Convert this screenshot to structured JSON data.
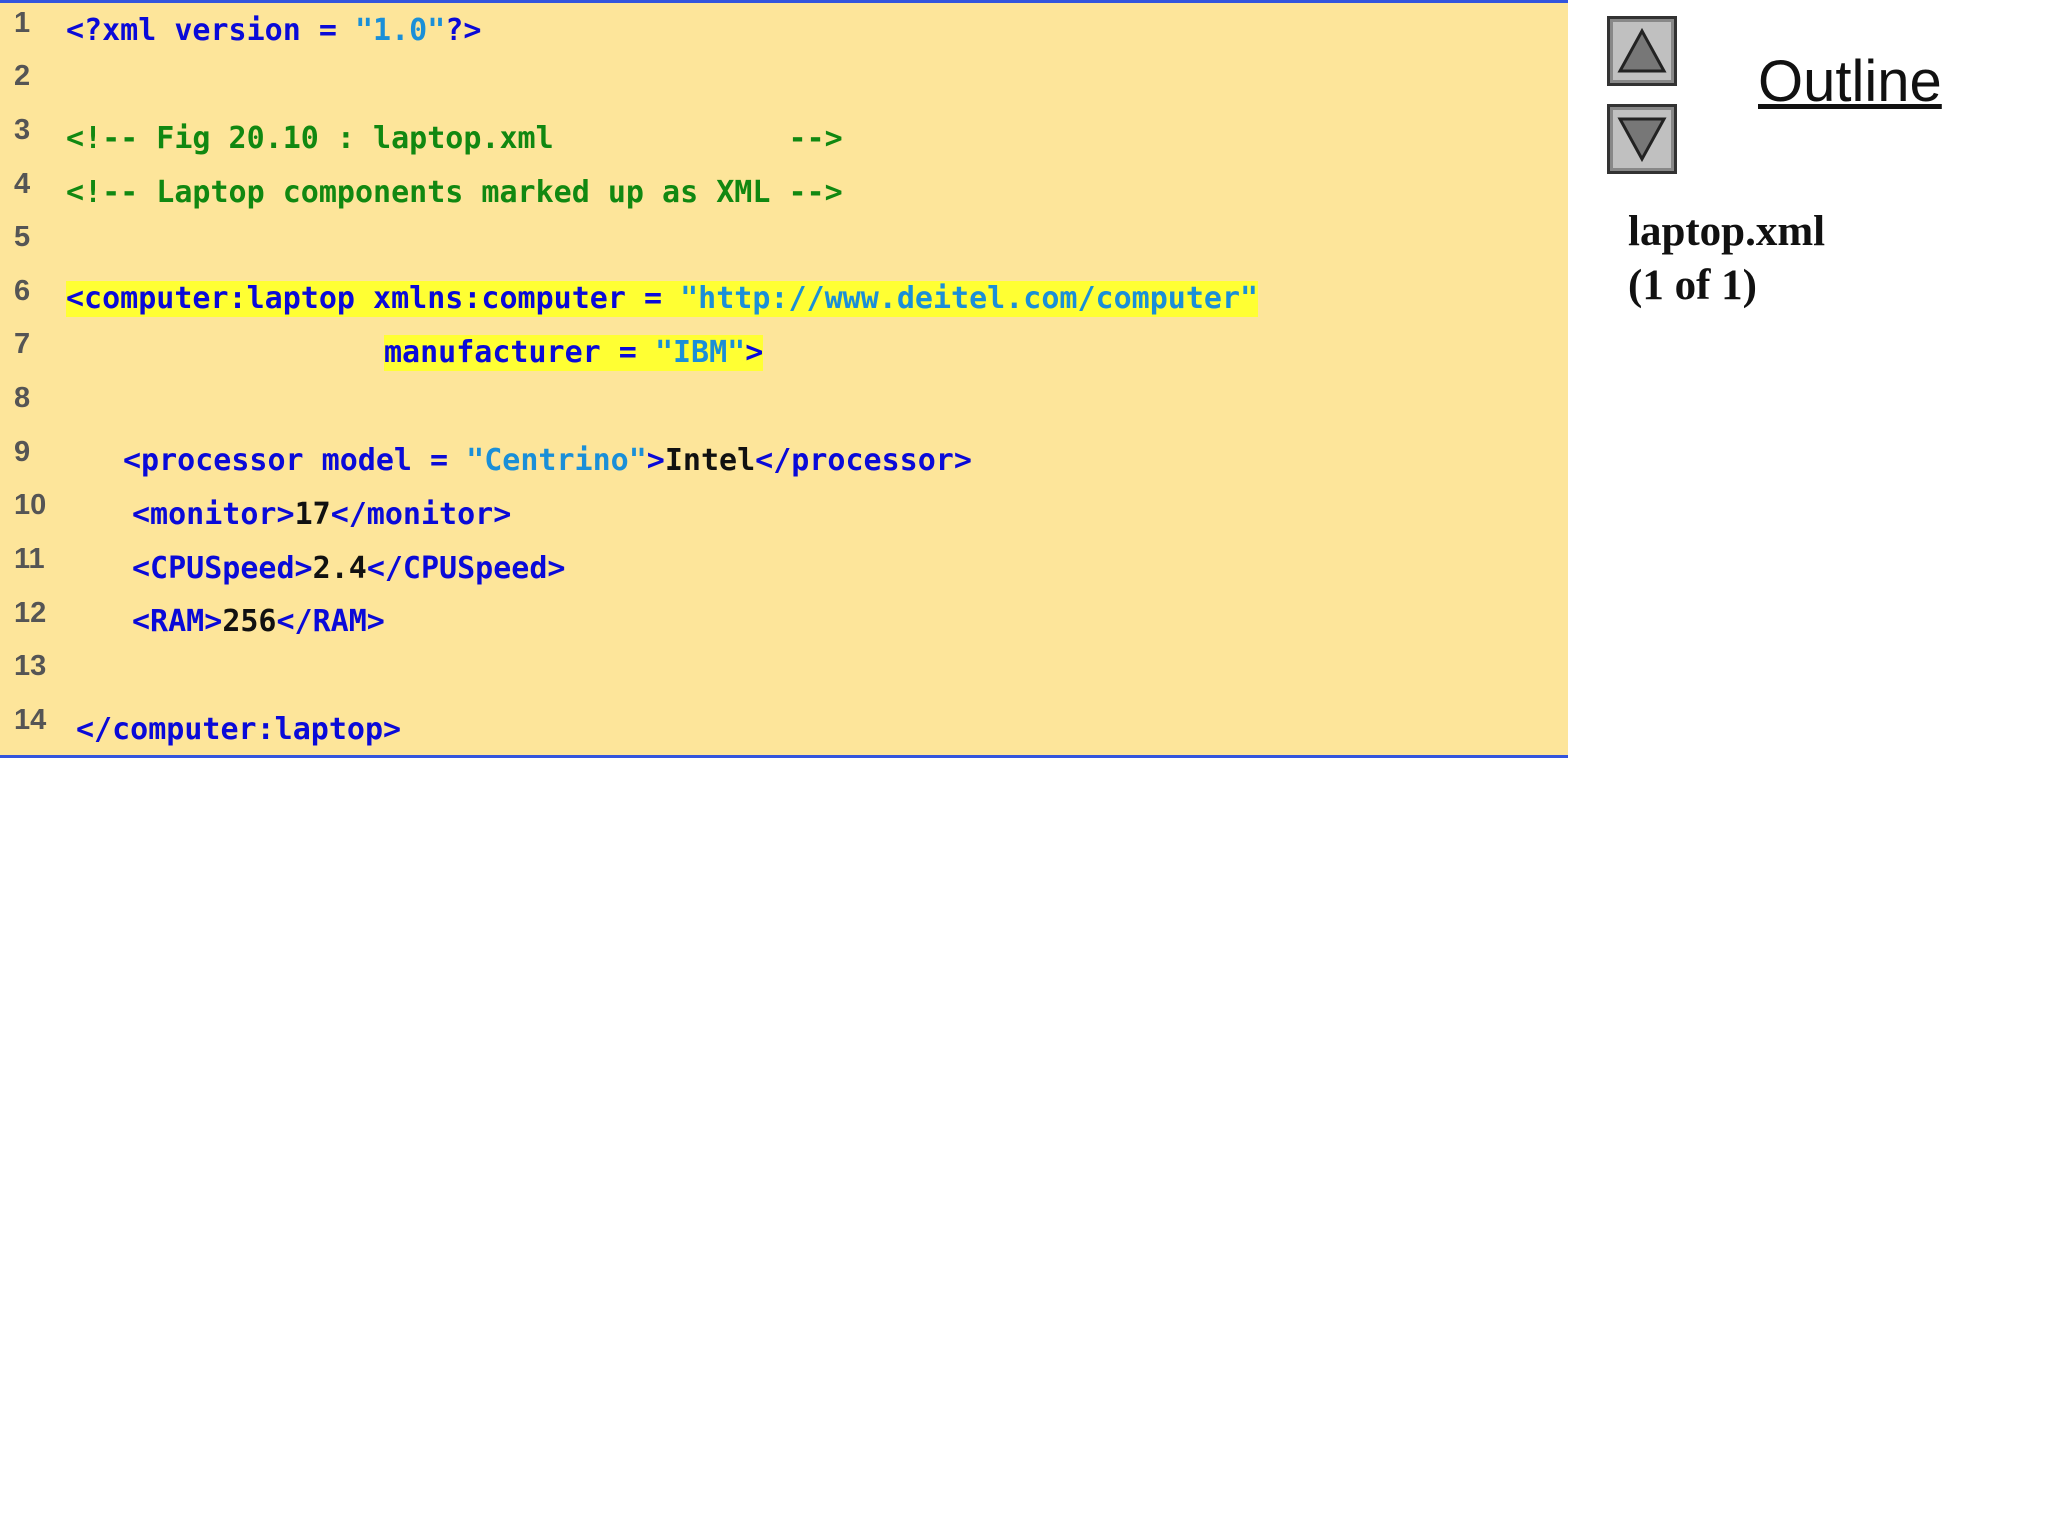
{
  "code": {
    "line_numbers": [
      "1",
      "2",
      "3",
      "4",
      "5",
      "6",
      "7",
      "8",
      "9",
      "10",
      "11",
      "12",
      "13",
      "14"
    ],
    "l1": {
      "a": "<?xml version = ",
      "b": "\"1.0\"",
      "c": "?>"
    },
    "l3": "<!-- Fig 20.10 : laptop.xml             -->",
    "l4": "<!-- Laptop components marked up as XML -->",
    "l6": {
      "a": "<computer:laptop xmlns:computer = ",
      "b": "\"http://www.deitel.com/computer\""
    },
    "l7": {
      "a": "manufacturer = ",
      "b": "\"IBM\"",
      "c": ">"
    },
    "l9": {
      "a": "<processor model = ",
      "b": "\"Centrino\"",
      "c": ">",
      "d": "Intel",
      "e": "</processor>"
    },
    "l10": {
      "a": "<monitor>",
      "b": "17",
      "c": "</monitor>"
    },
    "l11": {
      "a": "<CPUSpeed>",
      "b": "2.4",
      "c": "</CPUSpeed>"
    },
    "l12": {
      "a": "<RAM>",
      "b": "256",
      "c": "</RAM>"
    },
    "l14": "</computer:laptop>"
  },
  "sidebar": {
    "outline_title": "Outline",
    "file_name": "laptop.xml",
    "page_indicator": "(1 of 1)",
    "up_icon": "triangle-up-icon",
    "down_icon": "triangle-down-icon"
  },
  "colors": {
    "panel_bg": "#fde59a",
    "border": "#3355dd",
    "tag": "#0a0ad8",
    "attr_value": "#1a8fd8",
    "comment": "#118811",
    "highlight": "#ffff33"
  }
}
